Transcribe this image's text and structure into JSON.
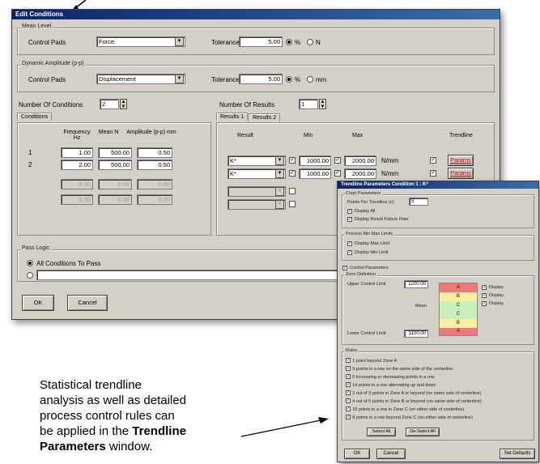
{
  "edit_conditions": {
    "title": "Edit Conditions",
    "mean_level": {
      "group_label": "Mean Level",
      "control_pads_label": "Control Pads",
      "control_pads_value": "Force",
      "tolerance_label": "Tolerance",
      "tolerance_value": "5.00",
      "unit_pct": "%",
      "unit_abs": "N"
    },
    "dynamic_amplitude": {
      "group_label": "Dynamic Amplitude (p-p)",
      "control_pads_label": "Control Pads",
      "control_pads_value": "Displacement",
      "tolerance_label": "Tolerance",
      "tolerance_value": "5.00",
      "unit_pct": "%",
      "unit_abs": "mm"
    },
    "num_conditions_label": "Number Of Conditions",
    "num_conditions_value": "2",
    "num_results_label": "Number Of Results",
    "num_results_value": "1",
    "conditions_tab": "Conditions",
    "conditions_headers": [
      "Frequency Hz",
      "Mean N",
      "Amplitude (p-p) mm"
    ],
    "conditions_rows": [
      {
        "index": "1",
        "freq": "1.00",
        "mean": "500.00",
        "amp": "0.50"
      },
      {
        "index": "2",
        "freq": "2.00",
        "mean": "500.00",
        "amp": "0.50"
      },
      {
        "index": "",
        "freq": "0.00",
        "mean": "0.00",
        "amp": "0.00"
      },
      {
        "index": "",
        "freq": "0.00",
        "mean": "0.00",
        "amp": "0.00"
      }
    ],
    "results_tabs": [
      "Results 1",
      "Results 2"
    ],
    "results_headers": [
      "Result",
      "Min",
      "Max",
      "Trendline"
    ],
    "results_rows": [
      {
        "result": "K*",
        "min": "1000.00",
        "max": "2000.00",
        "unit": "N/mm",
        "trend": "Params"
      },
      {
        "result": "K*",
        "min": "1000.00",
        "max": "2000.00",
        "unit": "N/mm",
        "trend": "Params"
      }
    ],
    "pass_logic": {
      "group_label": "Pass Logic",
      "option_all": "All Conditions To Pass"
    },
    "ok_label": "OK",
    "cancel_label": "Cancel"
  },
  "trendline": {
    "title": "Trendline Parameters Condition 1 : K*",
    "chart_params": {
      "group_label": "Chart Parameters",
      "points_label": "Points Per Trendline (n)",
      "points_value": "5",
      "display_all": "Display All",
      "display_result": "Display Result Failure Rate"
    },
    "process_min_max": {
      "group_label": "Process Min Max Limits",
      "display_max": "Display Max Limit",
      "display_min": "Display Min Limit"
    },
    "control_params_label": "Control Parameters",
    "zone_label": "Zone Definition",
    "upper_label": "Upper Control Limit",
    "upper_value": "1200.00",
    "lower_label": "Lower Control Limit",
    "lower_value": "1100.00",
    "mean_label": "Mean",
    "zones": [
      "A",
      "B",
      "C",
      "C",
      "B",
      "A"
    ],
    "zone_colors": [
      "#f07878",
      "#f6f0a0",
      "#c8f0b8",
      "#c8f0b8",
      "#f6f0a0",
      "#f07878"
    ],
    "zone_options": [
      "Display",
      "Display",
      "Display"
    ],
    "rules_label": "Rules",
    "rules": [
      "1 point beyond Zone A",
      "9 points in a row on the same side of the centerline",
      "6 increasing or decreasing points in a row",
      "14 points in a row alternating up and down",
      "2 out of 3 points in Zone A or beyond (on same side of centerline)",
      "4 out of 5 points in Zone B or beyond (on same side of centerline)",
      "15 points in a row in Zone C (on either side of centerline)",
      "8 points in a row beyond Zone C (on either side of centerline)"
    ],
    "select_all": "Select All",
    "deselect_all": "De-Select All",
    "ok_label": "OK",
    "cancel_label": "Cancel",
    "defaults_label": "Set Defaults"
  },
  "caption": {
    "line1": "Statistical trendline",
    "line2": "analysis as well as detailed",
    "line3": "process control rules can",
    "line4_prefix": "be applied in the ",
    "line4_bold": "Trendline",
    "line5_bold": "Parameters",
    "line5_suffix": " window."
  }
}
